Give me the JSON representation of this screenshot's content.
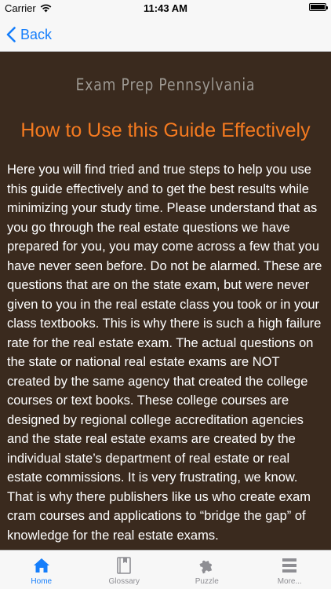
{
  "status_bar": {
    "carrier": "Carrier",
    "time": "11:43 AM",
    "icons": [
      "wifi-icon",
      "battery-icon"
    ]
  },
  "nav": {
    "back_label": "Back"
  },
  "content": {
    "brand": "Exam Prep Pennsylvania",
    "heading": "How to Use this Guide Effectively",
    "body": "Here you will find tried and true steps to help you use this guide effectively and to get the best results while minimizing your study time. Please understand that as you go through the real estate questions we have prepared for you, you may come across a few that you have never seen before. Do not be alarmed. These are questions that are on the state exam, but were never given to you in the real estate class you took or in your class textbooks. This is why there is such a high failure rate for the real estate exam. The actual questions on the state or national real estate exams are NOT created by the same agency that created the college courses or text books. These college courses are designed by regional college accreditation agencies and the state real estate exams are created by the individual state’s department of real estate or real estate commissions. It is very frustrating, we know. That is why there publishers like us who create exam cram courses and applications to “bridge the gap” of knowledge for the real estate exams."
  },
  "tabs": [
    {
      "label": "Home",
      "icon": "home-icon",
      "active": true
    },
    {
      "label": "Glossary",
      "icon": "book-icon",
      "active": false
    },
    {
      "label": "Puzzle",
      "icon": "puzzle-icon",
      "active": false
    },
    {
      "label": "More...",
      "icon": "menu-icon",
      "active": false
    }
  ],
  "colors": {
    "background": "#3a2a1e",
    "heading": "#f47a20",
    "accent": "#157efb",
    "inactive_tab": "#8e8e93"
  }
}
